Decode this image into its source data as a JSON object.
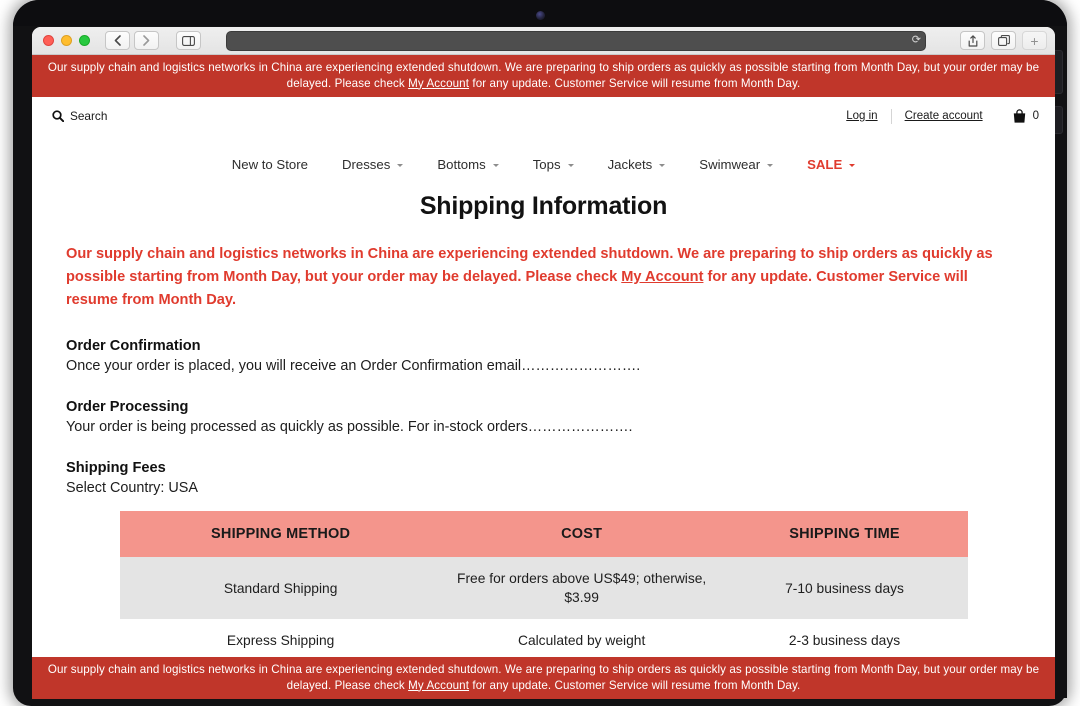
{
  "browser": {
    "window_controls": [
      "close",
      "minimize",
      "maximize"
    ],
    "back_label": "‹",
    "forward_label": "›",
    "sidebar_icon": "sidebar-icon",
    "url_value": "",
    "url_placeholder": "",
    "reload_icon": "reload-icon",
    "share_icon": "share-icon",
    "tabs_icon": "tab-overview-icon",
    "new_tab_label": "+"
  },
  "announcement": {
    "text_before": "Our supply chain and logistics networks in China are experiencing extended shutdown. We are preparing to ship orders as quickly as possible starting from Month Day, but your order may be delayed. Please check ",
    "link": "My Account",
    "text_after": " for any update. Customer Service will resume from Month Day."
  },
  "store_header": {
    "search_icon": "search-icon",
    "search_label": "Search",
    "login_label": "Log in",
    "create_account_label": "Create account",
    "cart_icon": "shopping-bag-icon",
    "cart_count": "0"
  },
  "nav": {
    "items": [
      {
        "label": "New to Store",
        "has_caret": false,
        "sale": false
      },
      {
        "label": "Dresses",
        "has_caret": true,
        "sale": false
      },
      {
        "label": "Bottoms",
        "has_caret": true,
        "sale": false
      },
      {
        "label": "Tops",
        "has_caret": true,
        "sale": false
      },
      {
        "label": "Jackets",
        "has_caret": true,
        "sale": false
      },
      {
        "label": "Swimwear",
        "has_caret": true,
        "sale": false
      },
      {
        "label": "SALE",
        "has_caret": true,
        "sale": true
      }
    ]
  },
  "main": {
    "title": "Shipping Information",
    "alert": {
      "text_before": "Our supply chain and logistics networks in China are experiencing extended shutdown. We are preparing to ship orders as quickly as possible starting from Month Day, but your order may be delayed. Please check ",
      "link": "My Account",
      "text_after": " for any update. Customer Service will resume from Month Day."
    },
    "sections": [
      {
        "heading": "Order Confirmation",
        "body": "Once your order is placed, you will receive an Order Confirmation email……………………."
      },
      {
        "heading": "Order Processing",
        "body": "Your order is being processed as quickly as possible. For in-stock orders…………………."
      }
    ],
    "fees": {
      "heading": "Shipping Fees",
      "country_line": "Select Country: USA",
      "columns": [
        "SHIPPING METHOD",
        "COST",
        "SHIPPING TIME"
      ],
      "rows": [
        {
          "method": "Standard Shipping",
          "cost": "Free for orders above US$49; otherwise, $3.99",
          "time": "7-10 business days"
        },
        {
          "method": "Express Shipping",
          "cost": "Calculated by weight",
          "time": "2-3 business days"
        }
      ]
    }
  },
  "colors": {
    "banner_red": "#c0362a",
    "alert_red": "#e03b2e",
    "table_header_salmon": "#f4958c",
    "table_row_alt": "#e4e4e4"
  }
}
